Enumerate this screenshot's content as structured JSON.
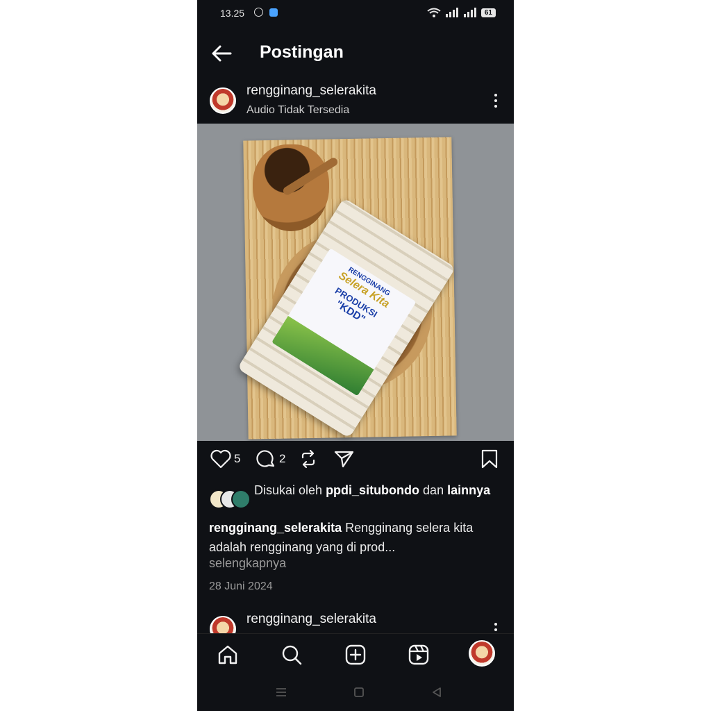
{
  "status": {
    "time": "13.25",
    "battery": "61"
  },
  "topbar": {
    "title": "Postingan"
  },
  "post": {
    "username": "rengginang_selerakita",
    "subtitle": "Audio Tidak Tersedia",
    "like_count": "5",
    "comment_count": "2",
    "liked_by_prefix": "Disukai oleh ",
    "liked_by_user": "ppdi_situbondo",
    "liked_by_mid": " dan ",
    "liked_by_others": "lainnya",
    "caption_user": "rengginang_selerakita",
    "caption_text": " Rengginang selera kita adalah rengginang yang di prod...",
    "more_label": "selengkapnya",
    "date": "28 Juni 2024",
    "image": {
      "label_line1": "RENGGINANG",
      "label_line2": "Selera Kita",
      "label_line3": "PRODUKSI",
      "label_line4": "\"KDD\""
    }
  },
  "next_post": {
    "username": "rengginang_selerakita"
  },
  "nav": {
    "items": [
      "home-icon",
      "search-icon",
      "create-icon",
      "reels-icon",
      "profile-avatar"
    ]
  },
  "colors": {
    "background": "#0f1115",
    "text": "#f2f2f2",
    "muted": "#9a9a9a"
  }
}
